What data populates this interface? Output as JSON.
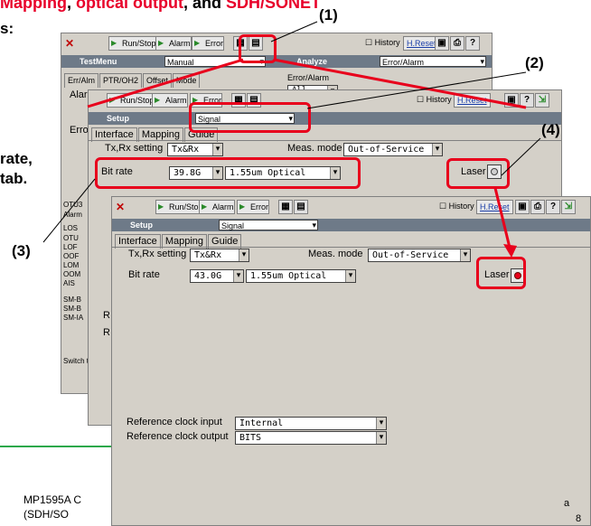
{
  "heading": {
    "part1": "Mapping",
    "sep1": ", ",
    "part2": "optical output",
    "sep2": ", and ",
    "part3": "SDH/SONET"
  },
  "left_text": {
    "line1": "s:",
    "line2": "rate,",
    "line3": "tab."
  },
  "callouts": {
    "c1": "(1)",
    "c2": "(2)",
    "c3": "(3)",
    "c4": "(4)"
  },
  "toolbar": {
    "run_stop": "Run/Stop",
    "alarm": "Alarm",
    "error": "Error",
    "history": "History",
    "h_reset": "H.Reset",
    "help": "?"
  },
  "win_back": {
    "bar_title": "TestMenu",
    "mode_value": "Manual",
    "analyze_label": "Analyze",
    "analyze_value": "Error/Alarm",
    "tabs": [
      "Err/Alm",
      "PTR/OH2",
      "Offset",
      "Mode"
    ],
    "err_alarm_label": "Error/Alarm",
    "all_value": "All",
    "alarm_label": "Alarm",
    "error_label": "Error",
    "side_labels": [
      "OTU3",
      "Alarm",
      "LOS",
      "OTU",
      "LOF",
      "OOF",
      "LOM",
      "OOM",
      "AIS",
      "SM-B",
      "SM-B",
      "SM-IA"
    ],
    "switch_label": "Switch th"
  },
  "win_mid": {
    "bar_title": "Setup",
    "signal_value": "Signal",
    "tabs": [
      "Interface",
      "Mapping",
      "Guide"
    ],
    "txrx_label": "Tx,Rx setting",
    "txrx_value": "Tx&Rx",
    "meas_label": "Meas. mode",
    "meas_value": "Out-of-Service",
    "bitrate_label": "Bit rate",
    "bitrate_value": "39.8G",
    "optical_value": "1.55um Optical",
    "laser_label": "Laser",
    "r1": "R",
    "r2": "R"
  },
  "win_front": {
    "bar_title": "Setup",
    "signal_value": "Signal",
    "tabs": [
      "Interface",
      "Mapping",
      "Guide"
    ],
    "txrx_label": "Tx,Rx setting",
    "txrx_value": "Tx&Rx",
    "meas_label": "Meas. mode",
    "meas_value": "Out-of-Service",
    "bitrate_label": "Bit rate",
    "bitrate_value": "43.0G",
    "optical_value": "1.55um Optical",
    "laser_label": "Laser",
    "refin_label": "Reference clock input",
    "refin_value": "Internal",
    "refout_label": "Reference clock output",
    "refout_value": "BITS"
  },
  "footer": {
    "line1": "MP1595A  C",
    "line2": "(SDH/SO",
    "page_num": "8",
    "right_frag": "a"
  },
  "colors": {
    "highlight": "#e8001c",
    "titlebar": "#6e7a88",
    "window_bg": "#d4d0c8",
    "rule_green": "#2aa84a"
  }
}
